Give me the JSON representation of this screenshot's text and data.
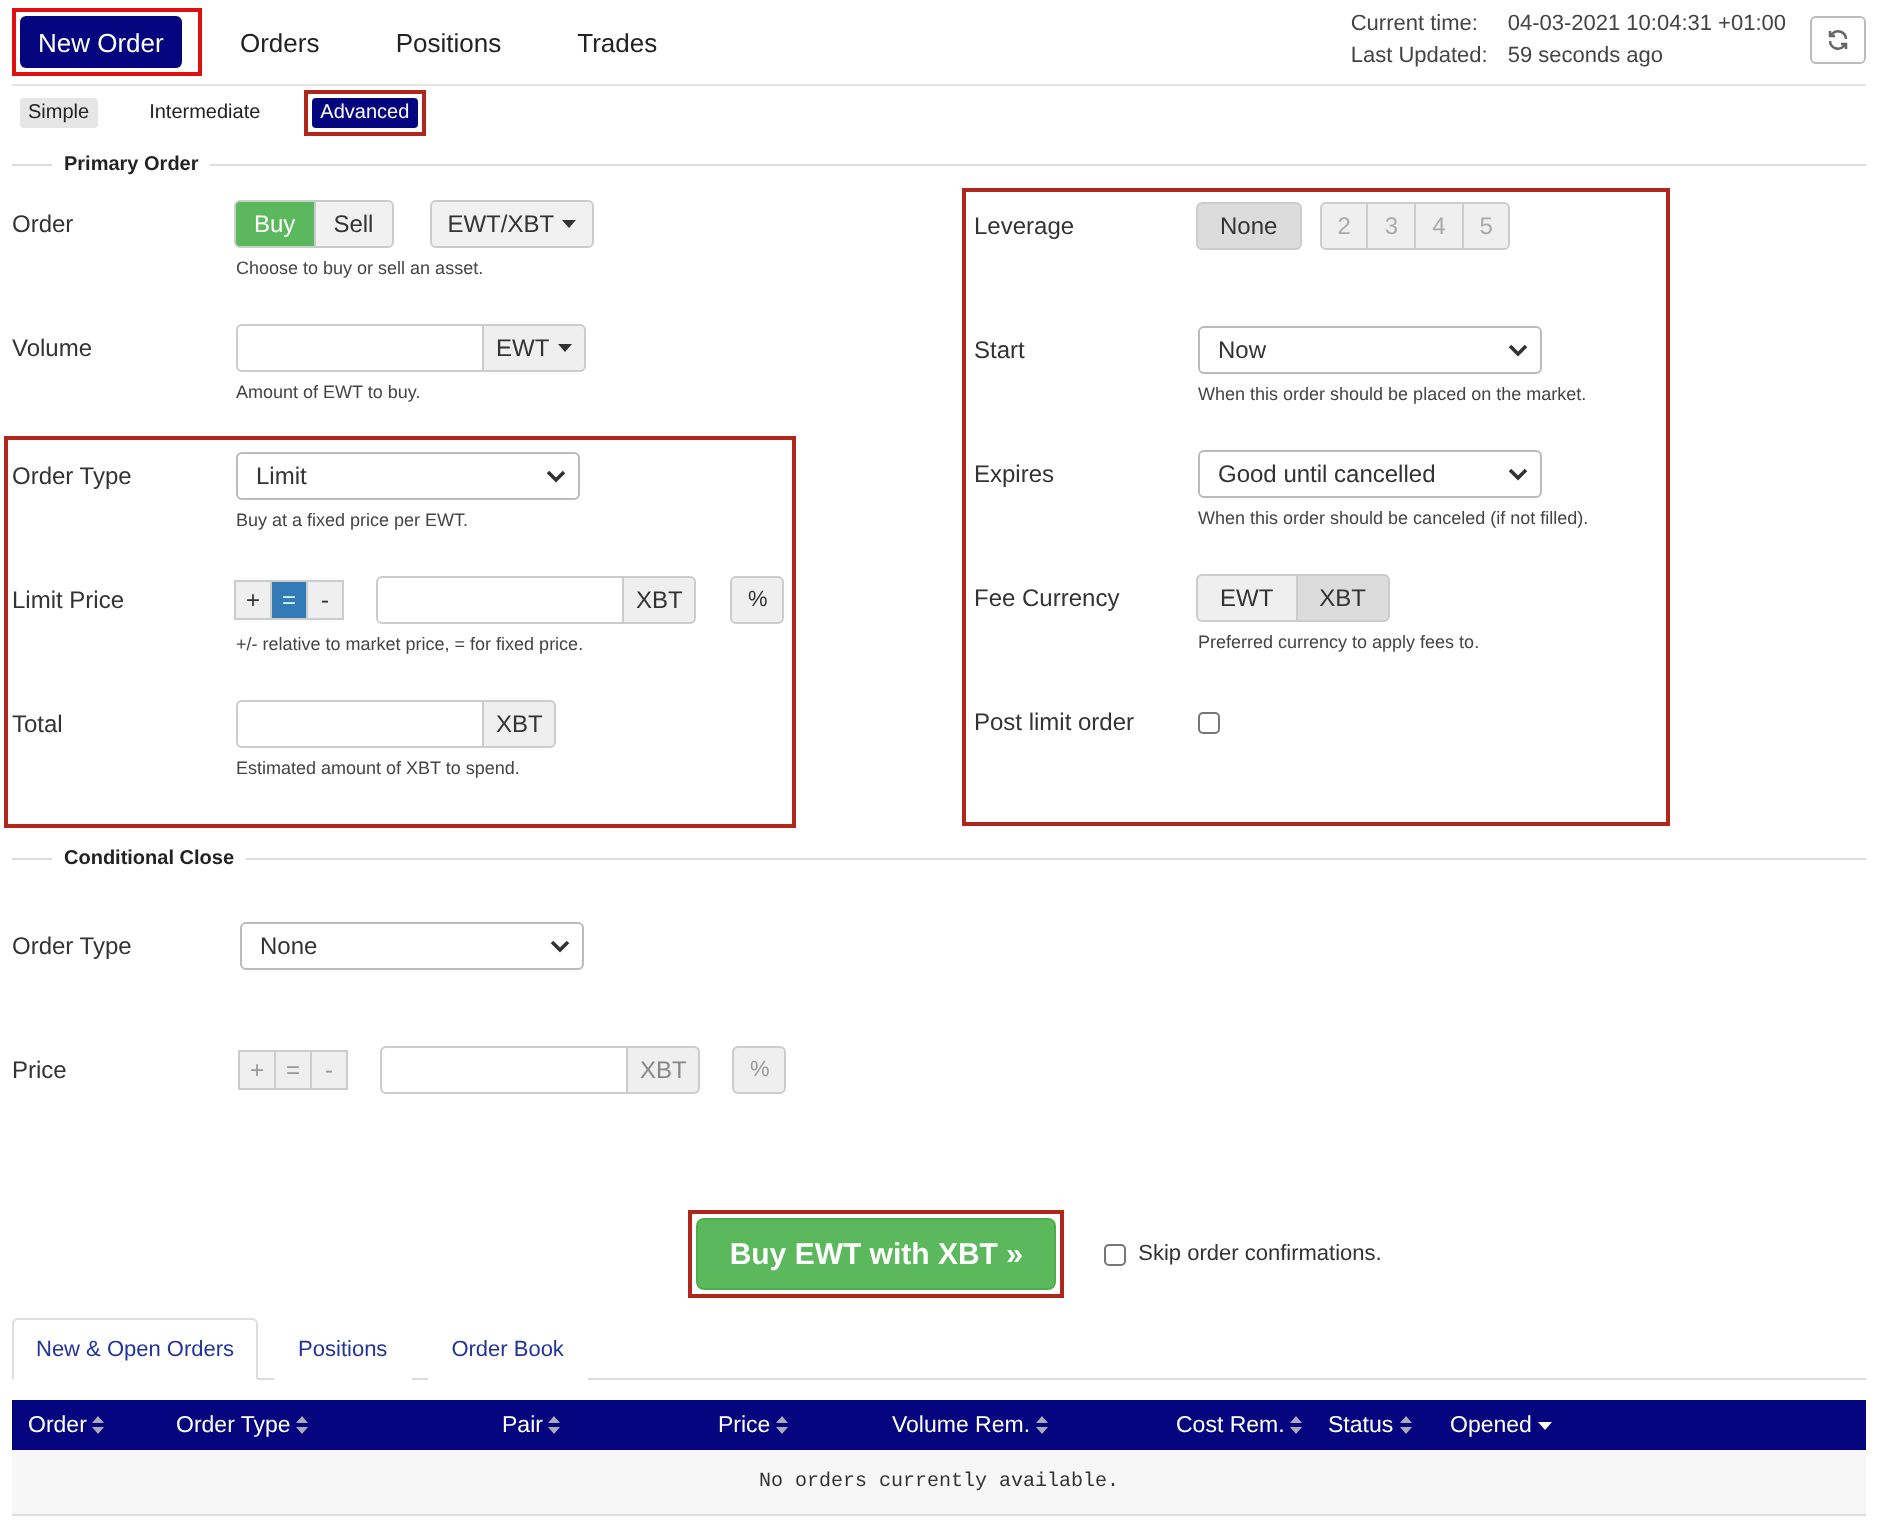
{
  "nav": {
    "tabs": [
      {
        "label": "New Order",
        "selected": true,
        "highlighted": true
      },
      {
        "label": "Orders",
        "selected": false,
        "highlighted": false
      },
      {
        "label": "Positions",
        "selected": false,
        "highlighted": false
      },
      {
        "label": "Trades",
        "selected": false,
        "highlighted": false
      }
    ]
  },
  "clock": {
    "current_label": "Current time:",
    "current_value": "04-03-2021 10:04:31 +01:00",
    "updated_label": "Last Updated:",
    "updated_value": "59 seconds ago"
  },
  "modes": [
    {
      "label": "Simple",
      "selected": false,
      "highlighted": false,
      "kind": "grey"
    },
    {
      "label": "Intermediate",
      "selected": false,
      "highlighted": false,
      "kind": "plain"
    },
    {
      "label": "Advanced",
      "selected": true,
      "highlighted": true,
      "kind": "plain"
    }
  ],
  "primary_order": {
    "legend": "Primary Order",
    "left_groups": [
      {
        "highlighted": false,
        "rows": [
          {
            "kind": "side",
            "label": "Order",
            "options": [
              {
                "label": "Buy",
                "selected": true
              },
              {
                "label": "Sell",
                "selected": false
              }
            ],
            "pair": "EWT/XBT",
            "hint": "Choose to buy or sell an asset."
          },
          {
            "kind": "amount",
            "label": "Volume",
            "unit": "EWT",
            "dropdown": true,
            "hint": "Amount of EWT to buy."
          }
        ]
      },
      {
        "highlighted": true,
        "rows": [
          {
            "kind": "select",
            "label": "Order Type",
            "value": "Limit",
            "hint": "Buy at a fixed price per EWT."
          },
          {
            "kind": "price",
            "label": "Limit Price",
            "disabled": false,
            "adjust": [
              {
                "label": "+",
                "selected": false
              },
              {
                "label": "=",
                "selected": true
              },
              {
                "label": "-",
                "selected": false
              }
            ],
            "unit": "XBT",
            "percent": "%",
            "hint": "+/- relative to market price, = for fixed price."
          },
          {
            "kind": "amount",
            "label": "Total",
            "unit": "XBT",
            "dropdown": false,
            "hint": "Estimated amount of XBT to spend."
          }
        ]
      }
    ],
    "right_group": {
      "highlighted": true,
      "rows": [
        {
          "kind": "segmented",
          "label": "Leverage",
          "options": [
            {
              "label": "None",
              "selected": true,
              "disabled": false
            },
            {
              "label": "2",
              "selected": false,
              "disabled": true
            },
            {
              "label": "3",
              "selected": false,
              "disabled": true
            },
            {
              "label": "4",
              "selected": false,
              "disabled": true
            },
            {
              "label": "5",
              "selected": false,
              "disabled": true
            }
          ]
        },
        {
          "kind": "select",
          "label": "Start",
          "value": "Now",
          "hint": "When this order should be placed on the market."
        },
        {
          "kind": "select",
          "label": "Expires",
          "value": "Good until cancelled",
          "hint": "When this order should be canceled (if not filled)."
        },
        {
          "kind": "segmented",
          "label": "Fee Currency",
          "options": [
            {
              "label": "EWT",
              "selected": false,
              "disabled": false
            },
            {
              "label": "XBT",
              "selected": true,
              "disabled": false
            }
          ],
          "hint": "Preferred currency to apply fees to."
        },
        {
          "kind": "checkbox",
          "label": "Post limit order",
          "checked": false
        }
      ]
    }
  },
  "conditional_close": {
    "legend": "Conditional Close",
    "rows": [
      {
        "kind": "select",
        "label": "Order Type",
        "value": "None"
      },
      {
        "kind": "price",
        "label": "Price",
        "disabled": true,
        "adjust": [
          {
            "label": "+",
            "selected": false
          },
          {
            "label": "=",
            "selected": false
          },
          {
            "label": "-",
            "selected": false
          }
        ],
        "unit": "XBT",
        "percent": "%"
      }
    ]
  },
  "submit": {
    "label": "Buy EWT with XBT »",
    "highlighted": true
  },
  "skip_confirm": {
    "label": "Skip order confirmations.",
    "checked": false
  },
  "bottom_tabs": [
    {
      "label": "New & Open Orders",
      "selected": true
    },
    {
      "label": "Positions",
      "selected": false
    },
    {
      "label": "Order Book",
      "selected": false
    }
  ],
  "table": {
    "columns": [
      {
        "label": "Order",
        "kind": "sortable"
      },
      {
        "label": "Order Type",
        "kind": "sortable"
      },
      {
        "label": "Pair",
        "kind": "sortable"
      },
      {
        "label": "Price",
        "kind": "sortable"
      },
      {
        "label": "Volume Rem.",
        "kind": "sortable"
      },
      {
        "label": "Cost Rem.",
        "kind": "sortable"
      },
      {
        "label": "Status",
        "kind": "sortable"
      },
      {
        "label": "Opened",
        "kind": "sorted"
      }
    ],
    "empty_message": "No orders currently available."
  }
}
